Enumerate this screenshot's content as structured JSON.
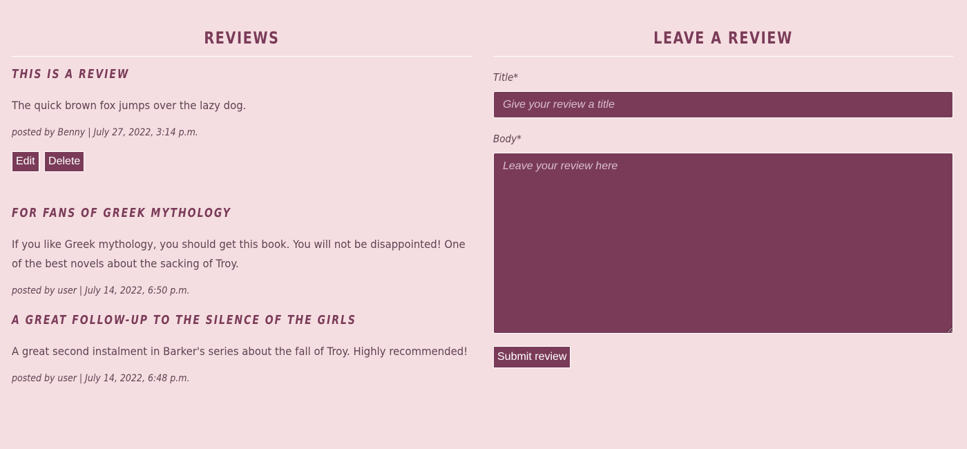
{
  "reviews_section": {
    "heading": "REVIEWS",
    "items": [
      {
        "title": "THIS IS A REVIEW",
        "body": "The quick brown fox jumps over the lazy dog.",
        "meta": "posted by Benny | July 27, 2022, 3:14 p.m.",
        "edit_label": "Edit",
        "delete_label": "Delete"
      },
      {
        "title": "FOR FANS OF GREEK MYTHOLOGY",
        "body": "If you like Greek mythology, you should get this book. You will not be disappointed! One of the best novels about the sacking of Troy.",
        "meta": "posted by user | July 14, 2022, 6:50 p.m."
      },
      {
        "title": "A GREAT FOLLOW-UP TO THE SILENCE OF THE GIRLS",
        "body": "A great second instalment in Barker's series about the fall of Troy. Highly recommended!",
        "meta": "posted by user | July 14, 2022, 6:48 p.m."
      }
    ]
  },
  "review_form": {
    "heading": "LEAVE A REVIEW",
    "title_label": "Title*",
    "title_placeholder": "Give your review a title",
    "title_value": "",
    "body_label": "Body*",
    "body_placeholder": "Leave your review here",
    "body_value": "",
    "submit_label": "Submit review"
  },
  "colors": {
    "background": "#f5dee1",
    "accent": "#7a3b58",
    "text": "#5f4152"
  }
}
